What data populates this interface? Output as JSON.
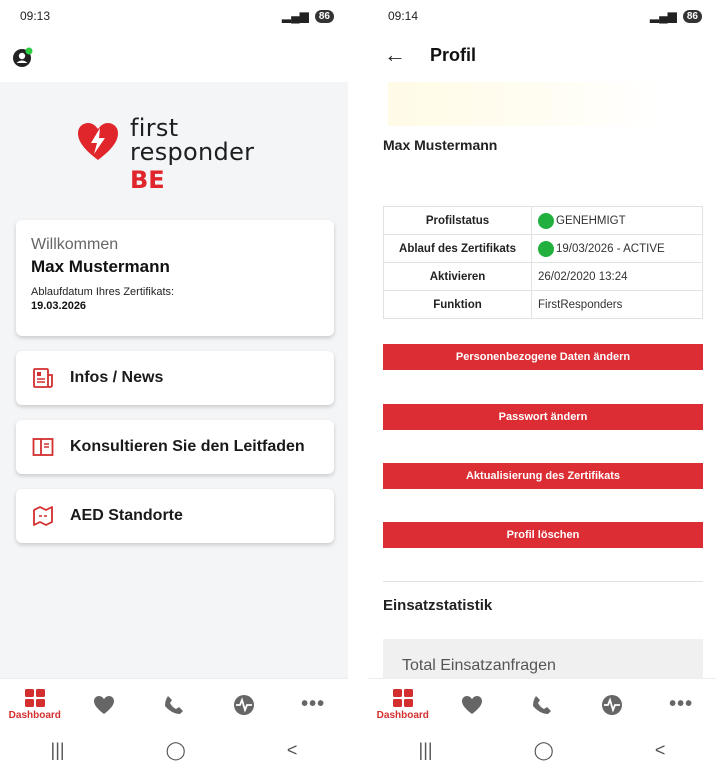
{
  "left": {
    "status": {
      "time": "09:13",
      "battery": "86"
    },
    "logo": {
      "line1": "first",
      "line2": "responder",
      "line3": "BE"
    },
    "welcome": {
      "title": "Willkommen",
      "name": "Max Mustermann",
      "cert_label": "Ablaufdatum Ihres Zertifikats:",
      "cert_date": "19.03.2026"
    },
    "menu": [
      {
        "label": "Infos / News",
        "icon": "news-icon"
      },
      {
        "label": "Konsultieren Sie den Leitfaden",
        "icon": "book-icon"
      },
      {
        "label": "AED Standorte",
        "icon": "map-icon"
      }
    ],
    "nav": {
      "dashboard_label": "Dashboard"
    }
  },
  "right": {
    "status": {
      "time": "09:14",
      "battery": "86"
    },
    "header": {
      "title": "Profil"
    },
    "name": "Max Mustermann",
    "profile_rows": [
      {
        "key": "Profilstatus",
        "value": "GENEHMIGT",
        "dot": true
      },
      {
        "key": "Ablauf des Zertifikats",
        "value": "19/03/2026 - ACTIVE",
        "dot": true
      },
      {
        "key": "Aktivieren",
        "value": "26/02/2020 13:24",
        "dot": false
      },
      {
        "key": "Funktion",
        "value": "FirstResponders",
        "dot": false
      }
    ],
    "buttons": {
      "edit_personal": "Personenbezogene Daten ändern",
      "change_password": "Passwort ändern",
      "update_cert": "Aktualisierung des Zertifikats",
      "delete_profile": "Profil löschen"
    },
    "stats": {
      "title": "Einsatzstatistik",
      "total_label": "Total Einsatzanfragen"
    },
    "nav": {
      "dashboard_label": "Dashboard"
    }
  },
  "colors": {
    "accent": "#d32f2f",
    "button_red": "#db2d33",
    "status_green": "#21b03d"
  }
}
